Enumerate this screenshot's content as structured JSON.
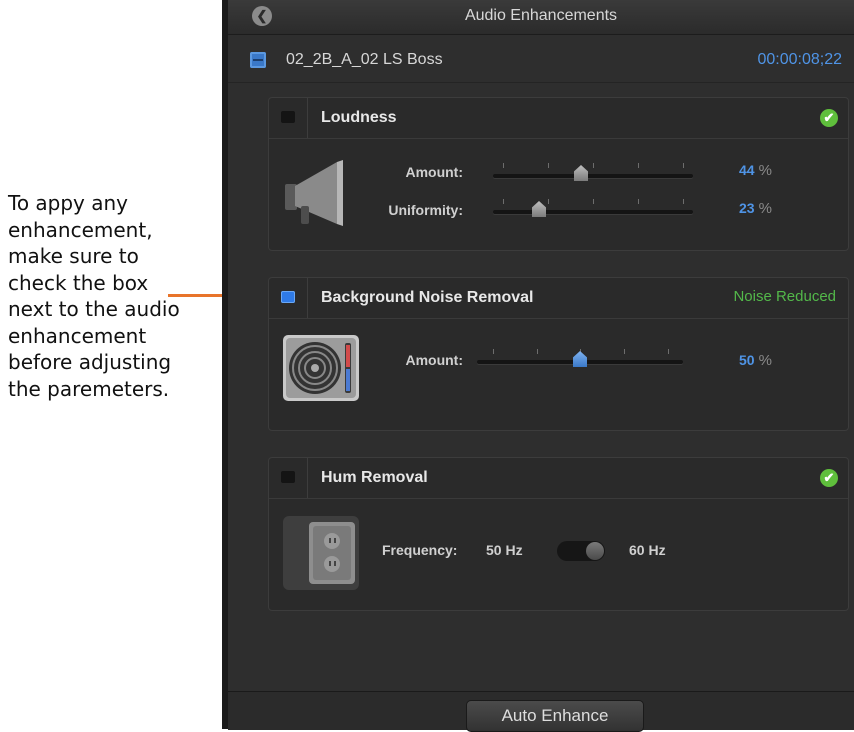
{
  "annotation": {
    "text": "To appy any\nenhancement,\nmake sure to\ncheck the box\nnext to the audio\nenhancement\nbefore adjusting\nthe paremeters.",
    "accent_color": "#e8742a"
  },
  "panel": {
    "title": "Audio Enhancements",
    "back_icon": "back-chevron-icon",
    "clip": {
      "name": "02_2B_A_02 LS Boss",
      "timecode": "00:00:08;22"
    }
  },
  "sections": {
    "loudness": {
      "title": "Loudness",
      "checked": false,
      "status_icon": "green-check-icon",
      "amount": {
        "label": "Amount:",
        "value": "44",
        "unit": "%",
        "fraction": 0.44
      },
      "uniformity": {
        "label": "Uniformity:",
        "value": "23",
        "unit": "%",
        "fraction": 0.23
      }
    },
    "noise": {
      "title": "Background Noise Removal",
      "checked": true,
      "status_text": "Noise Reduced",
      "amount": {
        "label": "Amount:",
        "value": "50",
        "unit": "%",
        "fraction": 0.5
      }
    },
    "hum": {
      "title": "Hum Removal",
      "checked": false,
      "status_icon": "green-check-icon",
      "frequency_label": "Frequency:",
      "option_a": "50 Hz",
      "option_b": "60 Hz",
      "selected": "60 Hz"
    }
  },
  "footer": {
    "auto_enhance_label": "Auto Enhance"
  },
  "colors": {
    "accent_blue": "#4f94e6",
    "status_green": "#53b84a",
    "panel_bg": "#2e2e2e"
  }
}
